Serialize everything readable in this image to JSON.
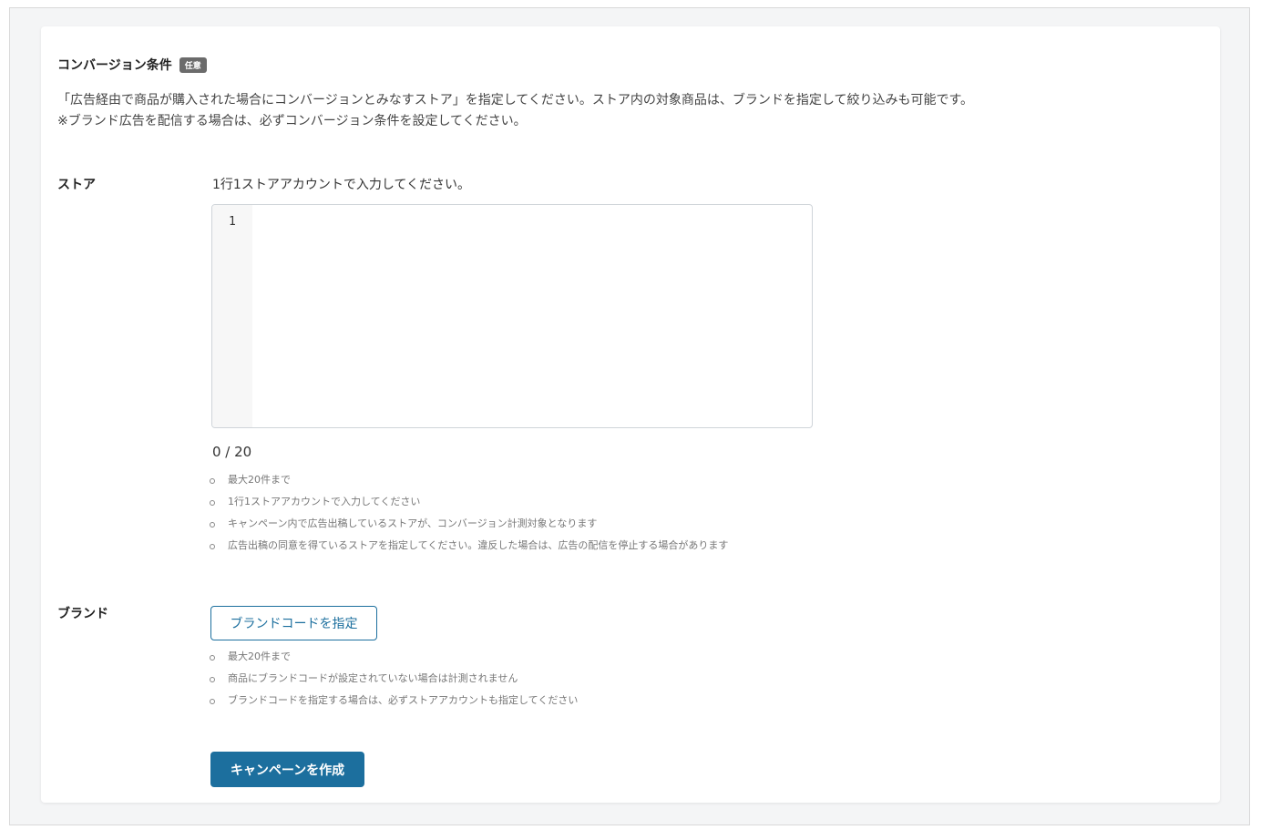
{
  "conversion": {
    "title": "コンバージョン条件",
    "badge": "任意",
    "desc_line1": "「広告経由で商品が購入された場合にコンバージョンとみなすストア」を指定してください。ストア内の対象商品は、ブランドを指定して絞り込みも可能です。",
    "desc_line2": "※ブランド広告を配信する場合は、必ずコンバージョン条件を設定してください。"
  },
  "store": {
    "label": "ストア",
    "instruction": "1行1ストアアカウントで入力してください。",
    "line_number": "1",
    "counter": "0 / 20",
    "notes": [
      "最大20件まで",
      "1行1ストアアカウントで入力してください",
      "キャンペーン内で広告出稿しているストアが、コンバージョン計測対象となります",
      "広告出稿の同意を得ているストアを指定してください。違反した場合は、広告の配信を停止する場合があります"
    ]
  },
  "brand": {
    "label": "ブランド",
    "button_label": "ブランドコードを指定",
    "notes": [
      "最大20件まで",
      "商品にブランドコードが設定されていない場合は計測されません",
      "ブランドコードを指定する場合は、必ずストアアカウントも指定してください"
    ]
  },
  "actions": {
    "create_label": "キャンペーンを作成"
  },
  "colors": {
    "primary": "#1c6f9e",
    "badge": "#6b6b6b"
  }
}
